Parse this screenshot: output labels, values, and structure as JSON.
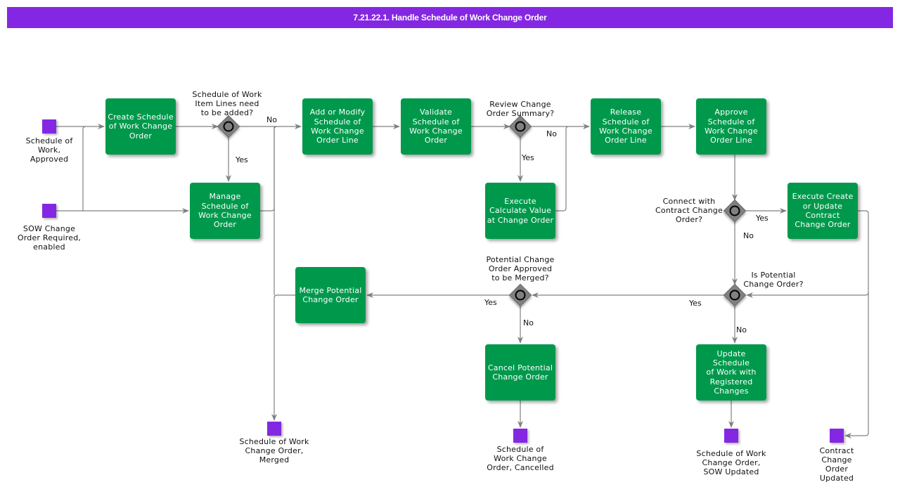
{
  "title": "7.21.22.1. Handle Schedule of Work Change Order",
  "colors": {
    "header": "#8427e2",
    "task": "#00994c",
    "event": "#8427e2",
    "gateway": "#808080",
    "connector": "#808080"
  },
  "events": {
    "start_sow_approved": "Schedule of\nWork,\nApproved",
    "start_sow_change_required": "SOW Change\nOrder Required,\nenabled",
    "end_merged": "Schedule of Work\nChange Order,\nMerged",
    "end_cancelled": "Schedule of\nWork Change\nOrder, Cancelled",
    "end_sow_updated": "Schedule of Work\nChange Order,\nSOW Updated",
    "end_contract_updated": "Contract\nChange\nOrder\nUpdated"
  },
  "tasks": {
    "create_sow_co": "Create Schedule\nof Work Change\nOrder",
    "manage_sow_co": "Manage\nSchedule of\nWork Change\nOrder",
    "add_modify_line": "Add or Modify\nSchedule of\nWork Change\nOrder Line",
    "validate_sow_co": "Validate\nSchedule of\nWork Change\nOrder",
    "execute_calc_value": "Execute\nCalculate Value\nat Change Order",
    "release_line": "Release\nSchedule of\nWork Change\nOrder Line",
    "approve_line": "Approve\nSchedule of\nWork Change\nOrder Line",
    "execute_contract_co": "Execute Create\nor Update\nContract\nChange Order",
    "merge_potential": "Merge Potential\nChange Order",
    "cancel_potential": "Cancel Potential\nChange Order",
    "update_sow": "Update Schedule\nof Work with\nRegistered\nChanges"
  },
  "gateways": {
    "item_lines_added": "Schedule of Work\nItem Lines need\nto be added?",
    "review_summary": "Review Change\nOrder Summary?",
    "connect_contract": "Connect with\nContract Change\nOrder?",
    "is_potential": "Is Potential\nChange Order?",
    "approved_merge": "Potential Change\nOrder Approved\nto be Merged?"
  },
  "flow_labels": {
    "g1_no": "No",
    "g1_yes": "Yes",
    "g2_no": "No",
    "g2_yes": "Yes",
    "g3_yes": "Yes",
    "g3_no": "No",
    "g4_yes": "Yes",
    "g4_no": "No",
    "g5_yes": "Yes",
    "g5_no": "No"
  }
}
